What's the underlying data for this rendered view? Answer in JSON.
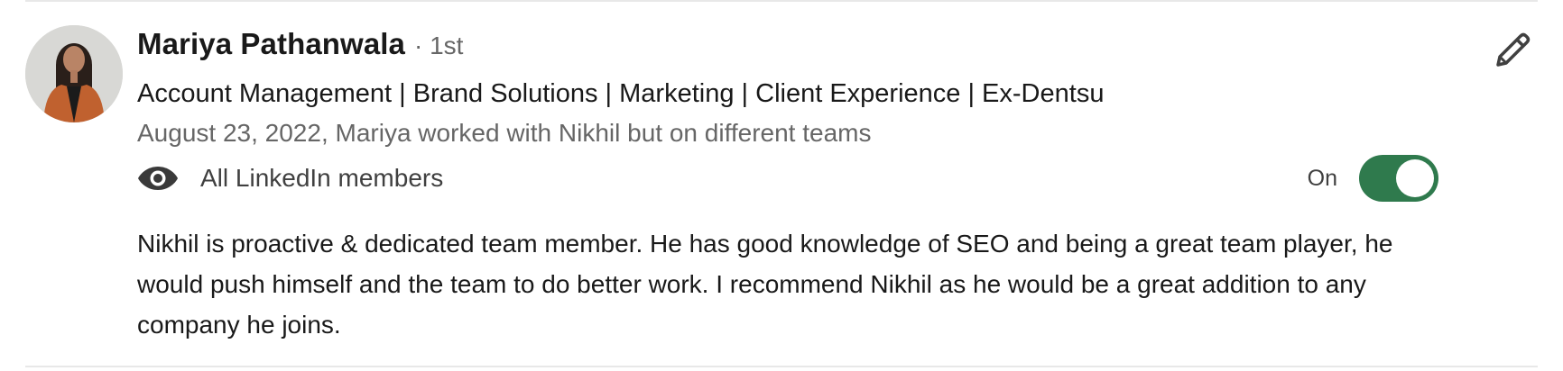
{
  "recommendation": {
    "name": "Mariya Pathanwala",
    "degree": "· 1st",
    "headline": "Account Management | Brand Solutions | Marketing | Client Experience | Ex-Dentsu",
    "meta": "August 23, 2022, Mariya worked with Nikhil but on different teams",
    "visibility": {
      "icon": "eye-icon",
      "label": "All LinkedIn members"
    },
    "toggle": {
      "label": "On",
      "state": true,
      "color": "#2f7a4d"
    },
    "text": "Nikhil is proactive & dedicated team member. He has good knowledge of SEO and being a great team player, he would push himself and the team to do better work. I recommend Nikhil as he would be a great addition to any company he joins.",
    "edit_icon": "pencil-icon"
  }
}
